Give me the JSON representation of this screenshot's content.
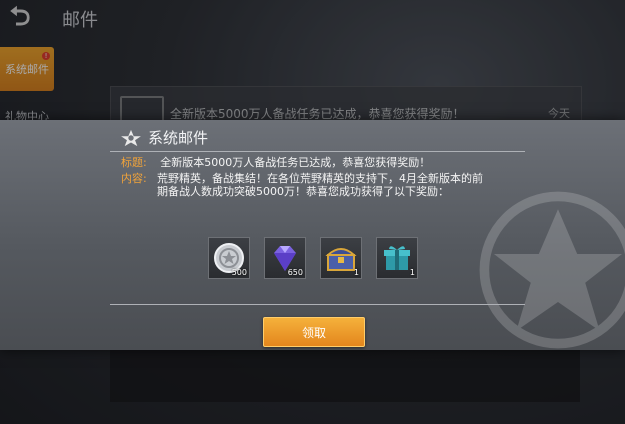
{
  "background": {
    "back_label": "⮌",
    "page_title": "邮件",
    "tabs": [
      "系统邮件",
      "礼物中心"
    ],
    "badge": "!",
    "mail_item": {
      "text": "全新版本5000万人备战任务已达成，恭喜您获得奖励！",
      "date": "今天"
    }
  },
  "modal": {
    "title": "系统邮件",
    "subject_label": "标题:",
    "subject": "全新版本5000万人备战任务已达成，恭喜您获得奖励！",
    "content_label": "内容:",
    "content": "荒野精英，备战集结！在各位荒野精英的支持下，4月全新版本的前期备战人数成功突破5000万！恭喜您成功获得了以下奖励：",
    "rewards": [
      {
        "icon": "silver-coin-icon",
        "qty": "500"
      },
      {
        "icon": "diamond-icon",
        "qty": "650"
      },
      {
        "icon": "treasure-chest-icon",
        "qty": "1"
      },
      {
        "icon": "gift-box-icon",
        "qty": "1"
      }
    ],
    "claim_label": "领取"
  },
  "colors": {
    "accent": "#e8901f",
    "label": "#f0a33a",
    "badge": "#e33b2b"
  }
}
